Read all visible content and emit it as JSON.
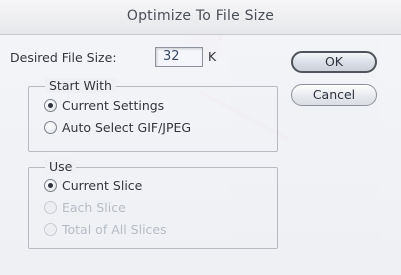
{
  "dialog": {
    "title": "Optimize To File Size",
    "desired_label": "Desired File Size:",
    "desired_value": "32",
    "desired_unit": "K"
  },
  "buttons": {
    "ok_label": "OK",
    "cancel_label": "Cancel"
  },
  "start_with": {
    "title": "Start With",
    "options": [
      {
        "label": "Current Settings",
        "selected": true,
        "enabled": true
      },
      {
        "label": "Auto Select GIF/JPEG",
        "selected": false,
        "enabled": true
      }
    ]
  },
  "use": {
    "title": "Use",
    "options": [
      {
        "label": "Current Slice",
        "selected": true,
        "enabled": true
      },
      {
        "label": "Each Slice",
        "selected": false,
        "enabled": false
      },
      {
        "label": "Total of All Slices",
        "selected": false,
        "enabled": false
      }
    ]
  }
}
